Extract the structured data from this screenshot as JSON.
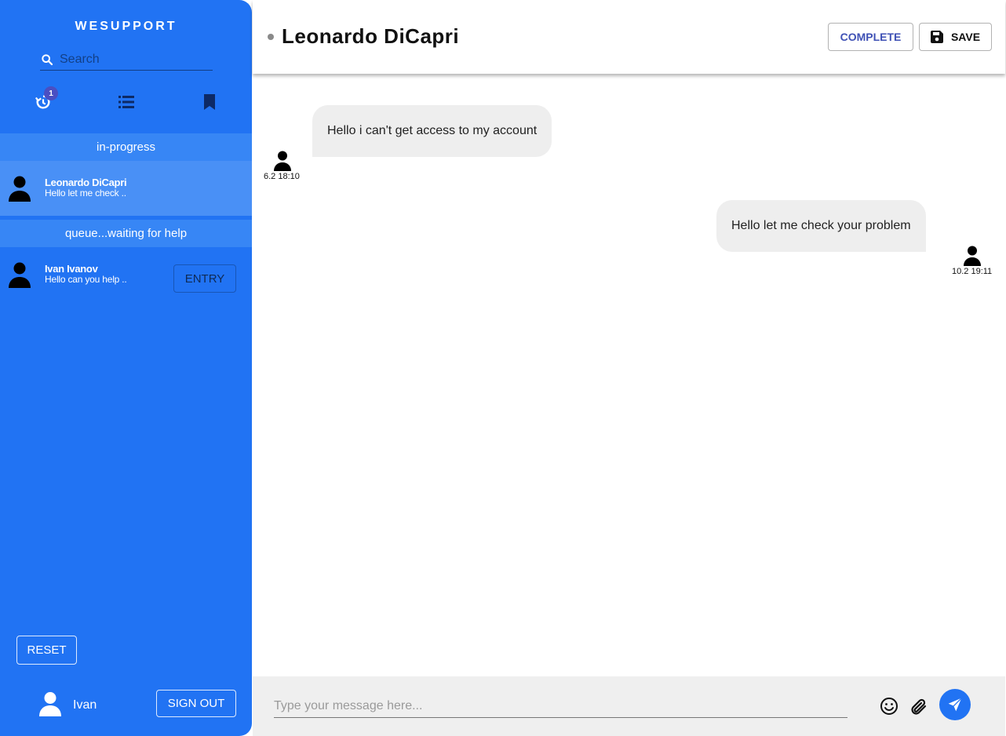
{
  "sidebar": {
    "brand": "WESUPPORT",
    "search_placeholder": "Search",
    "history_badge": "1",
    "sections": {
      "in_progress": "in-progress",
      "queue": "queue...waiting for help"
    },
    "active_chat": {
      "name": "Leonardo DiCapri",
      "preview": "Hello let me check .."
    },
    "queue_chat": {
      "name": "Ivan Ivanov",
      "preview": "Hello can you help ..",
      "entry_label": "ENTRY"
    },
    "reset_label": "RESET",
    "user_name": "Ivan",
    "signout_label": "SIGN OUT"
  },
  "header": {
    "title": "Leonardo DiCapri",
    "complete_label": "COMPLETE",
    "save_label": "SAVE"
  },
  "messages": [
    {
      "text": "Hello i can't get access to my account",
      "time": "6.2 18:10",
      "direction": "incoming"
    },
    {
      "text": "Hello let me check your problem",
      "time": "10.2 19:11",
      "direction": "outgoing"
    }
  ],
  "composer": {
    "placeholder": "Type your message here..."
  },
  "colors": {
    "sidebar": "#2173f3",
    "active_item": "#4990f6",
    "section_header": "#3786f5",
    "bubble": "#eeeeee",
    "complete_text": "#3f51b5"
  },
  "icons": {
    "search": "search-icon",
    "history": "history-icon",
    "list": "list-icon",
    "bookmark": "bookmark-icon",
    "user": "user-icon",
    "save": "floppy-disk-icon",
    "emoji": "smiley-icon",
    "attach": "paperclip-icon",
    "send": "send-icon"
  }
}
